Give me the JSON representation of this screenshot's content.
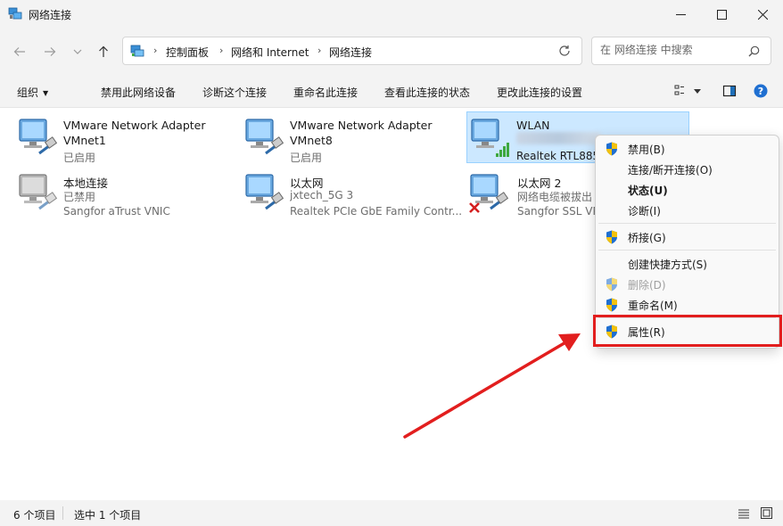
{
  "window": {
    "title": "网络连接",
    "icon": "network-connections-icon"
  },
  "address_bar": {
    "breadcrumbs": [
      "控制面板",
      "网络和 Internet",
      "网络连接"
    ]
  },
  "search": {
    "placeholder": "在 网络连接 中搜索"
  },
  "command_bar": {
    "organize": "组织",
    "disable_device": "禁用此网络设备",
    "diagnose": "诊断这个连接",
    "rename": "重命名此连接",
    "view_status": "查看此连接的状态",
    "change_settings": "更改此连接的设置"
  },
  "connections": [
    {
      "name": "VMware Network Adapter VMnet1",
      "line1": "VMware Network Adapter",
      "line2": "VMnet1",
      "line3": "已启用",
      "type": "ethernet",
      "status": "enabled"
    },
    {
      "name": "VMware Network Adapter VMnet8",
      "line1": "VMware Network Adapter",
      "line2": "VMnet8",
      "line3": "已启用",
      "type": "ethernet",
      "status": "enabled"
    },
    {
      "line1": "WLAN",
      "line2": "",
      "line3": "Realtek RTL885",
      "type": "wifi",
      "status": "selected"
    },
    {
      "line1": "本地连接",
      "line2": "已禁用",
      "line3": "Sangfor aTrust VNIC",
      "type": "ethernet",
      "status": "disabled"
    },
    {
      "line1": "以太网",
      "line2": "jxtech_5G 3",
      "line3": "Realtek PCIe GbE Family Contr...",
      "type": "ethernet",
      "status": "enabled"
    },
    {
      "line1": "以太网 2",
      "line2": "网络电缆被拔出",
      "line3": "Sangfor SSL VP",
      "type": "ethernet",
      "status": "unplugged"
    }
  ],
  "context_menu": {
    "items": [
      {
        "label": "禁用(B)",
        "shield": true
      },
      {
        "label": "连接/断开连接(O)",
        "shield": false
      },
      {
        "label": "状态(U)",
        "shield": false,
        "bold": true
      },
      {
        "label": "诊断(I)",
        "shield": false
      },
      {
        "label": "桥接(G)",
        "shield": true
      },
      {
        "label": "创建快捷方式(S)",
        "shield": false
      },
      {
        "label": "删除(D)",
        "shield": true,
        "disabled": true
      },
      {
        "label": "重命名(M)",
        "shield": true
      },
      {
        "label": "属性(R)",
        "shield": true,
        "highlighted": true
      }
    ]
  },
  "status_bar": {
    "item_count": "6 个项目",
    "selected_count": "选中 1 个项目"
  },
  "colors": {
    "accent": "#0067c0",
    "selection_bg": "#cce8ff",
    "annotation_red": "#e21e1e"
  }
}
